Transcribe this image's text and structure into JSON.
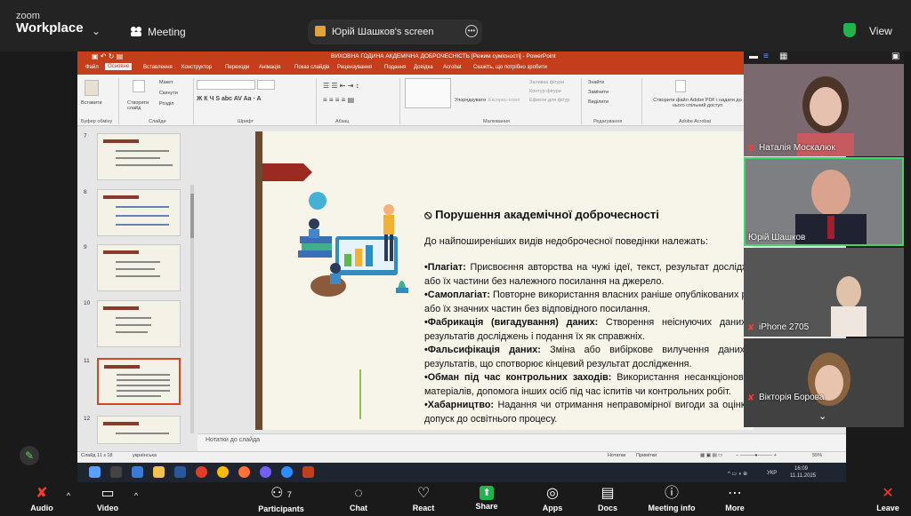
{
  "zoom": {
    "logo_line1": "zoom",
    "logo_line2": "Workplace",
    "chevron": "⌄",
    "meeting_label": "Meeting",
    "share_label": "Юрій Шашков's screen",
    "view_label": "View"
  },
  "ppt": {
    "window_title": "ВИХОВНА ГОДИНА АКДЕМІЧНА ДОБРОЧЕСНІСТЬ [Режим сумісності] - PowerPoint",
    "tabs": [
      "Файл",
      "Основне",
      "Вставлення",
      "Конструктор",
      "Переходи",
      "Анімація",
      "Показ слайдів",
      "Рецензування",
      "Подання",
      "Довідка",
      "Acrobat",
      "Скажіть, що потрібно зробити"
    ],
    "ribbon_groups": [
      "Буфер обміну",
      "Слайди",
      "Шрифт",
      "Абзац",
      "Малювання",
      "Редагування",
      "Adobe Acrobat"
    ],
    "ribbon_items": {
      "paste": "Вставити",
      "new_slide": "Створити слайд",
      "layout": "Макет",
      "reset": "Скинути",
      "section": "Розділ",
      "arrange": "Упорядкувати",
      "quick_styles": "Експрес-стилі",
      "shape_fill": "Заливка фігури",
      "shape_outline": "Контур фігури",
      "shape_effects": "Ефекти для фігур",
      "find": "Знайти",
      "replace": "Замінити",
      "select": "Виділити",
      "acrobat": "Створити файл Adobe PDF і надати до нього спільний доступ"
    },
    "thumb_numbers": [
      "7",
      "8",
      "9",
      "10",
      "11",
      "12"
    ],
    "notes_placeholder": "Нотатки до слайда",
    "status_left": "Слайд 11 з 18",
    "status_lang": "українська",
    "status_notes": "Нотатки",
    "status_comments": "Примітки",
    "zoom_level": "55%"
  },
  "slide": {
    "title": "Порушення академічної доброчесності",
    "intro": "До найпоширеніших видів недоброчесної поведінки належать:",
    "items": [
      {
        "term": "•Плагіат:",
        "text": " Присвоєння авторства на чужі ідеї, текст, результат досліджень або їх частини без належного посилання на джерело."
      },
      {
        "term": "•Самоплагіат:",
        "text": " Повторне використання власних раніше опублікованих робіт або їх значних частин без відповідного посилання."
      },
      {
        "term": "•Фабрикація (вигадування) даних:",
        "text": " Створення неіснуючих даних чи результатів досліджень і подання їх як справжніх."
      },
      {
        "term": "•Фальсифікація даних:",
        "text": " Зміна або вибіркове вилучення даних чи результатів, що спотворює кінцевий результат дослідження."
      },
      {
        "term": "•Обман під час контрольних заходів:",
        "text": " Використання несанкціонованих матеріалів, допомога інших осіб під час іспитів чи контрольних робіт."
      },
      {
        "term": "•Хабарництво:",
        "text": " Надання чи отримання неправомірної вигоди за оцінку чи допуск до освітнього процесу."
      }
    ]
  },
  "taskbar": {
    "lang": "УКР",
    "time": "16:09",
    "date": "11.11.2025"
  },
  "participants": [
    {
      "name": "Наталія Москалюк",
      "muted": true
    },
    {
      "name": "Юрій Шашков",
      "muted": false,
      "active": true
    },
    {
      "name": "iPhone 2705",
      "muted": true
    },
    {
      "name": "Вікторія Борова",
      "muted": true
    }
  ],
  "toolbar": [
    {
      "id": "audio",
      "icon": "🎤",
      "label": "Audio"
    },
    {
      "id": "video",
      "icon": "▭",
      "label": "Video"
    },
    {
      "id": "participants",
      "icon": "👥",
      "label": "Participants",
      "count": "7"
    },
    {
      "id": "chat",
      "icon": "💬",
      "label": "Chat"
    },
    {
      "id": "react",
      "icon": "♡",
      "label": "React"
    },
    {
      "id": "share",
      "icon": "⬆",
      "label": "Share"
    },
    {
      "id": "apps",
      "icon": "◎",
      "label": "Apps"
    },
    {
      "id": "docs",
      "icon": "▤",
      "label": "Docs"
    },
    {
      "id": "info",
      "icon": "ⓘ",
      "label": "Meeting info"
    },
    {
      "id": "more",
      "icon": "⋯",
      "label": "More"
    },
    {
      "id": "leave",
      "icon": "✕",
      "label": "Leave"
    }
  ],
  "colors": {
    "ppt_accent": "#c43e1c",
    "zoom_green": "#23b34d",
    "active_speaker": "#3fd66a"
  }
}
